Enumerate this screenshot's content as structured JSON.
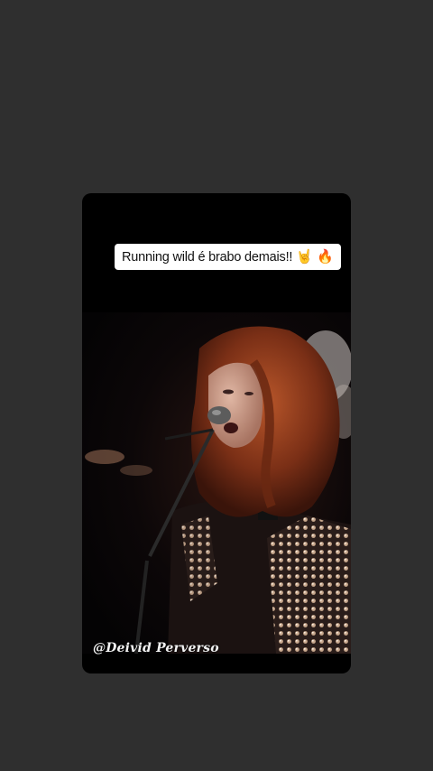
{
  "story": {
    "caption": "Running wild é brabo demais!!",
    "caption_emojis": [
      "🤘",
      "🔥"
    ],
    "watermark": "@Deivid Perverso"
  },
  "colors": {
    "background": "#2f2f2f",
    "card": "#000000",
    "hair": "#8a3a1c",
    "skin": "#c79a86"
  }
}
